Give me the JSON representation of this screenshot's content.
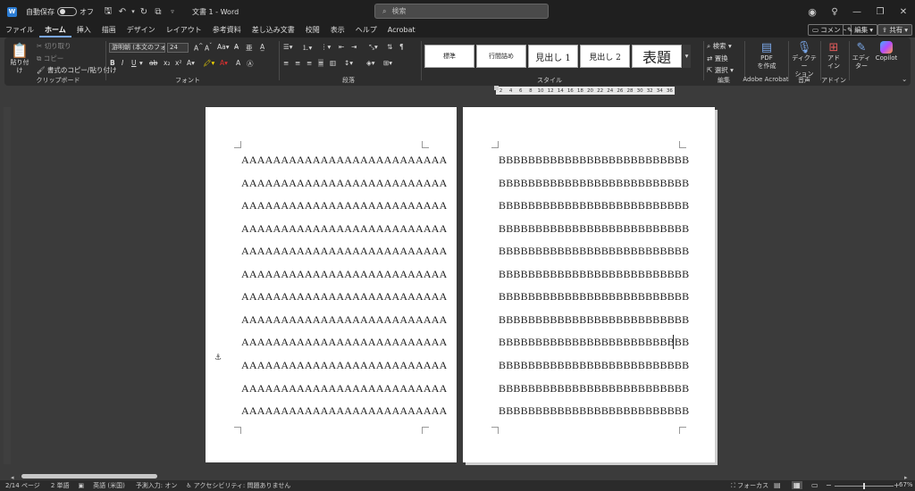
{
  "titlebar": {
    "autosave_label": "自動保存",
    "autosave_state": "オフ",
    "doc_title": "文書 1 - Word",
    "search_placeholder": "検索"
  },
  "menu": {
    "tabs": [
      "ファイル",
      "ホーム",
      "挿入",
      "描画",
      "デザイン",
      "レイアウト",
      "参考資料",
      "差し込み文書",
      "校閲",
      "表示",
      "ヘルプ",
      "Acrobat"
    ],
    "comment_button": "コメント",
    "edit_button": "編集",
    "share_button": "共有"
  },
  "ribbon": {
    "clipboard": {
      "label": "クリップボード",
      "paste": "貼り付け",
      "cut": "切り取り",
      "copy": "コピー",
      "format_painter": "書式のコピー/貼り付け"
    },
    "font": {
      "label": "フォント",
      "font_name": "游明朝 (本文のフォン",
      "font_size": "24"
    },
    "paragraph": {
      "label": "段落"
    },
    "styles": {
      "label": "スタイル",
      "items": [
        "標準",
        "行間詰め",
        "見出し 1",
        "見出し 2",
        "表題"
      ]
    },
    "editing": {
      "label": "編集",
      "find": "検索",
      "replace": "置換",
      "select": "選択"
    },
    "acrobat": {
      "label": "Adobe Acrobat",
      "create_pdf_1": "PDF",
      "create_pdf_2": "を作成"
    },
    "voice": {
      "label": "音声",
      "dictation_1": "ディクテー",
      "dictation_2": "ション"
    },
    "addins": {
      "label": "アドイン",
      "addins_1": "アド",
      "addins_2": "イン"
    },
    "editor_1": "エディ",
    "editor_2": "ター",
    "copilot": "Copilot"
  },
  "ruler": {
    "ticks": [
      "2",
      "4",
      "6",
      "8",
      "10",
      "12",
      "14",
      "16",
      "18",
      "20",
      "22",
      "24",
      "26",
      "28",
      "30",
      "32",
      "34",
      "36"
    ]
  },
  "document": {
    "page1_lines": [
      "AAAAAAAAAAAAAAAAAAAAAAAAAA",
      "AAAAAAAAAAAAAAAAAAAAAAAAAA",
      "AAAAAAAAAAAAAAAAAAAAAAAAAA",
      "AAAAAAAAAAAAAAAAAAAAAAAAAA",
      "AAAAAAAAAAAAAAAAAAAAAAAAAA",
      "AAAAAAAAAAAAAAAAAAAAAAAAAA",
      "AAAAAAAAAAAAAAAAAAAAAAAAAA",
      "AAAAAAAAAAAAAAAAAAAAAAAAAA",
      "AAAAAAAAAAAAAAAAAAAAAAAAAA",
      "AAAAAAAAAAAAAAAAAAAAAAAAAA",
      "AAAAAAAAAAAAAAAAAAAAAAAAAA",
      "AAAAAAAAAAAAAAAAAAAAAAAAAA"
    ],
    "page2_lines": [
      "BBBBBBBBBBBBBBBBBBBBBBBBBB",
      "BBBBBBBBBBBBBBBBBBBBBBBBBB",
      "BBBBBBBBBBBBBBBBBBBBBBBBBB",
      "BBBBBBBBBBBBBBBBBBBBBBBBBB",
      "BBBBBBBBBBBBBBBBBBBBBBBBBB",
      "BBBBBBBBBBBBBBBBBBBBBBBBBB",
      "BBBBBBBBBBBBBBBBBBBBBBBBBB",
      "BBBBBBBBBBBBBBBBBBBBBBBBBB",
      "BBBBBBBBBBBBBBBBBBBBBBBBBB",
      "BBBBBBBBBBBBBBBBBBBBBBBBBB",
      "BBBBBBBBBBBBBBBBBBBBBBBBBB",
      "BBBBBBBBBBBBBBBBBBBBBBBBBB"
    ]
  },
  "status": {
    "page": "2/14 ページ",
    "words": "2 単語",
    "language": "英語 (米国)",
    "predictive": "予測入力: オン",
    "accessibility": "アクセシビリティ: 問題ありません",
    "focus": "フォーカス",
    "zoom": "67%"
  }
}
